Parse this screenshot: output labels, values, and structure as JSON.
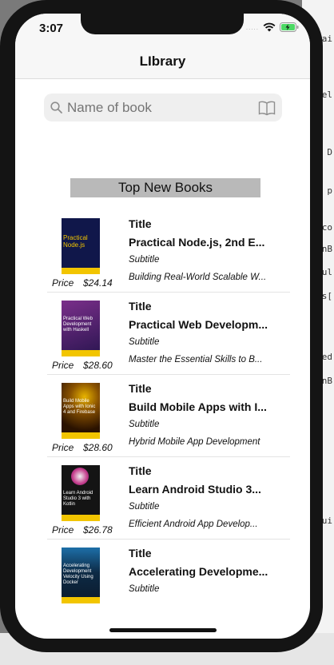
{
  "status_bar": {
    "time": "3:07",
    "signal": "....."
  },
  "nav": {
    "title": "LIbrary"
  },
  "search": {
    "placeholder": "Name of book"
  },
  "section": {
    "header": "Top New Books"
  },
  "books": [
    {
      "cover_text": "Practical Node.js",
      "cover_color": "#10174a",
      "title_label": "Title",
      "title": "Practical Node.js, 2nd E...",
      "subtitle_label": "Subtitle",
      "subtitle": "Building Real-World Scalable W...",
      "price_label": "Price",
      "price": "$24.14"
    },
    {
      "cover_text": "Practical Web Development with Haskell",
      "cover_color": "#4b1f6b",
      "title_label": "Title",
      "title": "Practical Web Developm...",
      "subtitle_label": "Subtitle",
      "subtitle": "Master the Essential Skills to B...",
      "price_label": "Price",
      "price": "$28.60"
    },
    {
      "cover_text": "Build Mobile Apps with Ionic 4 and Firebase",
      "cover_color": "#4a2a0a",
      "title_label": "Title",
      "title": "Build Mobile Apps with I...",
      "subtitle_label": "Subtitle",
      "subtitle": "Hybrid Mobile App Development",
      "price_label": "Price",
      "price": "$28.60"
    },
    {
      "cover_text": "Learn Android Studio 3 with Kotlin",
      "cover_color": "#1a1a1a",
      "title_label": "Title",
      "title": "Learn Android Studio 3...",
      "subtitle_label": "Subtitle",
      "subtitle": "Efficient Android App Develop...",
      "price_label": "Price",
      "price": "$26.78"
    },
    {
      "cover_text": "Accelerating Development Velocity Using Docker",
      "cover_color": "#0d2a45",
      "title_label": "Title",
      "title": "Accelerating Developme...",
      "subtitle_label": "Subtitle",
      "subtitle": "",
      "price_label": "",
      "price": ""
    }
  ],
  "colors": {
    "accent_yellow": "#f2c500",
    "screen_bg": "#ffffff",
    "navbar_bg": "#f7f7f7"
  }
}
